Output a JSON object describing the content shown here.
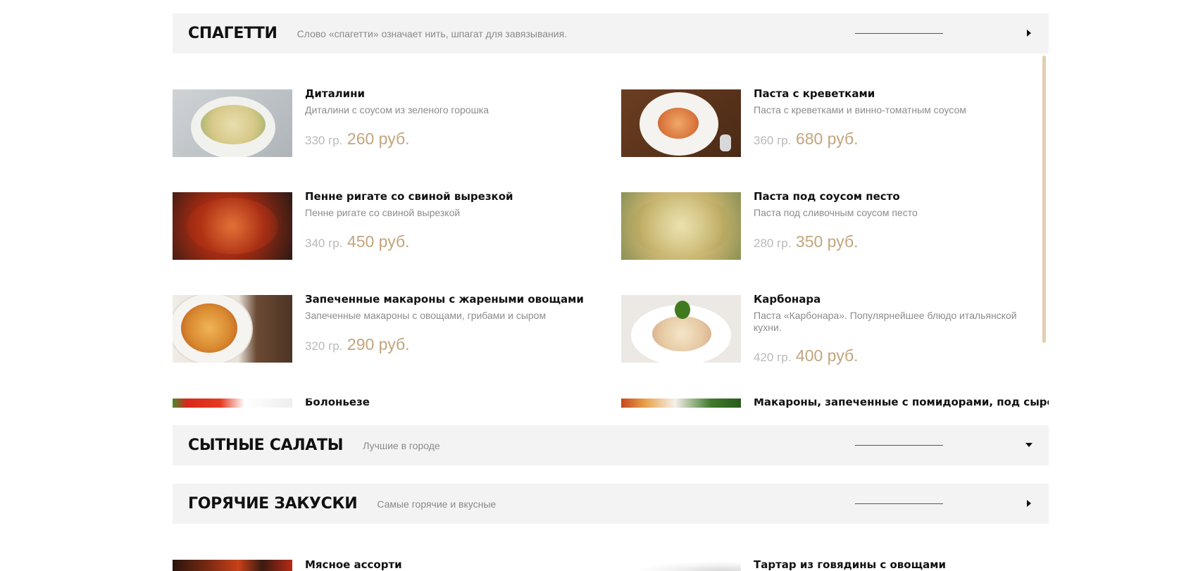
{
  "categories": [
    {
      "title": "СПАГЕТТИ",
      "subtitle": "Слово «спагетти» означает нить, шпагат для завязывания.",
      "expanded": true,
      "items": [
        {
          "name": "Диталини",
          "desc": "Диталини с соусом из зеленого горошка",
          "weight": "330 гр.",
          "price": "260 руб."
        },
        {
          "name": "Паста с креветками",
          "desc": "Паста с креветками и винно-томатным соусом",
          "weight": "360 гр.",
          "price": "680 руб."
        },
        {
          "name": "Пенне ригате со свиной вырезкой",
          "desc": "Пенне ригате со свиной вырезкой",
          "weight": "340 гр.",
          "price": "450 руб."
        },
        {
          "name": "Паста под соусом песто",
          "desc": "Паста под сливочным соусом песто",
          "weight": "280 гр.",
          "price": "350 руб."
        },
        {
          "name": "Запеченные макароны с жареными овощами",
          "desc": "Запеченные макароны с овощами, грибами и сыром",
          "weight": "320 гр.",
          "price": "290 руб."
        },
        {
          "name": "Карбонара",
          "desc": "Паста «Карбонара». Популярнейшее блюдо итальянской кухни.",
          "weight": "420 гр.",
          "price": "400 руб."
        },
        {
          "name": "Болоньезе",
          "desc": "",
          "weight": "",
          "price": ""
        },
        {
          "name": "Макароны, запеченные с помидорами, под сыром",
          "desc": "",
          "weight": "",
          "price": ""
        }
      ]
    },
    {
      "title": "СЫТНЫЕ САЛАТЫ",
      "subtitle": "Лучшие в городе",
      "expanded": false
    },
    {
      "title": "ГОРЯЧИЕ ЗАКУСКИ",
      "subtitle": "Самые горячие и вкусные",
      "expanded": true,
      "items": [
        {
          "name": "Мясное ассорти"
        },
        {
          "name": "Тартар из говядины с овощами"
        }
      ]
    }
  ],
  "colors": {
    "accent_price": "#c2a57d",
    "header_bg": "#f3f3f3",
    "scrollbar": "#e3cfae"
  },
  "icons": {
    "collapse_arrow": "triangle-right-icon",
    "expand_arrow": "triangle-down-icon"
  }
}
